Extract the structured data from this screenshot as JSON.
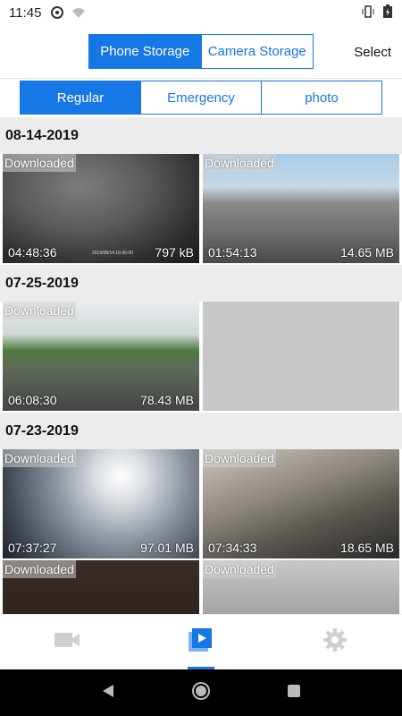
{
  "status_bar": {
    "time": "11:45"
  },
  "header": {
    "storage_tabs": [
      {
        "label": "Phone Storage",
        "active": true
      },
      {
        "label": "Camera Storage",
        "active": false
      }
    ],
    "select_label": "Select"
  },
  "type_tabs": [
    {
      "label": "Regular",
      "active": true
    },
    {
      "label": "Emergency",
      "active": false
    },
    {
      "label": "photo",
      "active": false
    }
  ],
  "groups": [
    {
      "date": "08-14-2019",
      "items": [
        {
          "badge": "Downloaded",
          "duration": "04:48:36",
          "size": "797 kB",
          "stamp": "2019/08/14 16:45:00"
        },
        {
          "badge": "Downloaded",
          "duration": "01:54:13",
          "size": "14.65 MB"
        }
      ]
    },
    {
      "date": "07-25-2019",
      "items": [
        {
          "badge": "Downloaded",
          "duration": "06:08:30",
          "size": "78.43 MB"
        }
      ]
    },
    {
      "date": "07-23-2019",
      "items": [
        {
          "badge": "Downloaded",
          "duration": "07:37:27",
          "size": "97.01 MB"
        },
        {
          "badge": "Downloaded",
          "duration": "07:34:33",
          "size": "18.65 MB"
        },
        {
          "badge": "Downloaded"
        },
        {
          "badge": "Downloaded"
        }
      ]
    }
  ],
  "bottom_nav": [
    {
      "icon": "video-camera-icon",
      "active": false
    },
    {
      "icon": "media-library-icon",
      "active": true
    },
    {
      "icon": "gear-icon",
      "active": false
    }
  ],
  "colors": {
    "accent": "#1677e6",
    "section_bg": "#ececec"
  }
}
